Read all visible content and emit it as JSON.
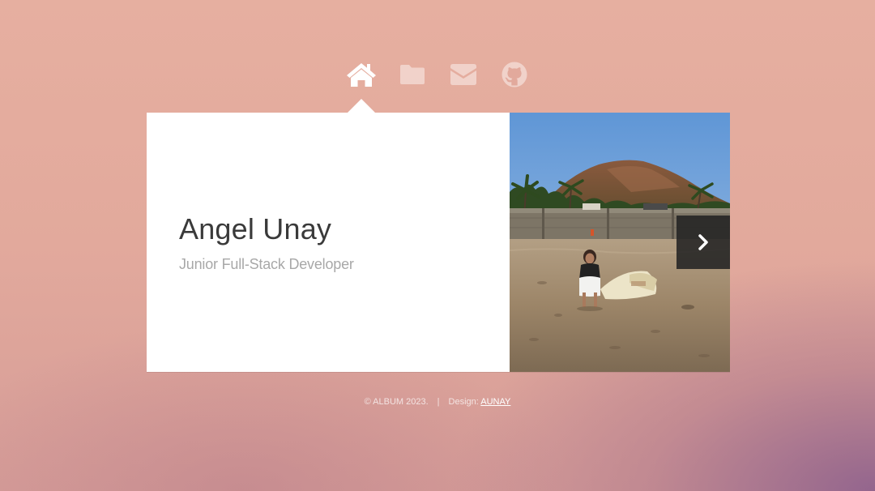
{
  "nav": {
    "items": [
      {
        "icon": "home-icon",
        "active": true
      },
      {
        "icon": "folder-icon",
        "active": false
      },
      {
        "icon": "envelope-icon",
        "active": false
      },
      {
        "icon": "github-icon",
        "active": false
      }
    ],
    "active_color": "#ffffff",
    "inactive_color": "rgba(255,255,255,0.45)"
  },
  "profile": {
    "name": "Angel Unay",
    "role": "Junior Full-Stack Developer"
  },
  "photo": {
    "next_icon": "chevron-right-icon"
  },
  "footer": {
    "copyright": "© ALBUM 2023.",
    "separator": "|",
    "design_label": "Design:",
    "design_link": "AUNAY"
  }
}
